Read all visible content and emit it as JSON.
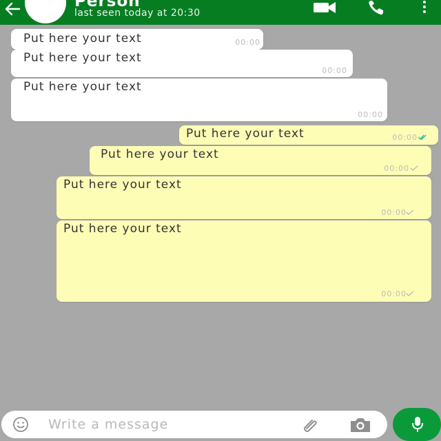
{
  "header": {
    "contact_name": "Person",
    "status": "last seen today at 20:30",
    "icons": [
      "back-arrow-icon",
      "avatar",
      "video-call-icon",
      "phone-icon",
      "more-vert-icon"
    ]
  },
  "messages": [
    {
      "direction": "incoming",
      "text": "Put here your text",
      "time": "00:00"
    },
    {
      "direction": "incoming",
      "text": "Put here your text",
      "time": "00:00"
    },
    {
      "direction": "incoming",
      "text": "Put here your text",
      "time": "00:00"
    },
    {
      "direction": "outgoing",
      "text": "Put here your text",
      "time": "00:00",
      "status": "read"
    },
    {
      "direction": "outgoing",
      "text": "Put here your text",
      "time": "00:00",
      "status": "sent"
    },
    {
      "direction": "outgoing",
      "text": "Put here your text",
      "time": "00:00",
      "status": "sent"
    },
    {
      "direction": "outgoing",
      "text": "Put here your text",
      "time": "00:00",
      "status": "sent"
    }
  ],
  "composer": {
    "placeholder": "Write a message",
    "value": "",
    "icons": [
      "emoji-icon",
      "attach-icon",
      "camera-icon",
      "mic-icon"
    ]
  },
  "colors": {
    "header": "#077d22",
    "background": "#a8a8a8",
    "incoming_bubble": "#ffffff",
    "outgoing_bubble": "#fdfdb6",
    "mic_button": "#0a9a3a",
    "read_tick": "#2bb5a0"
  }
}
